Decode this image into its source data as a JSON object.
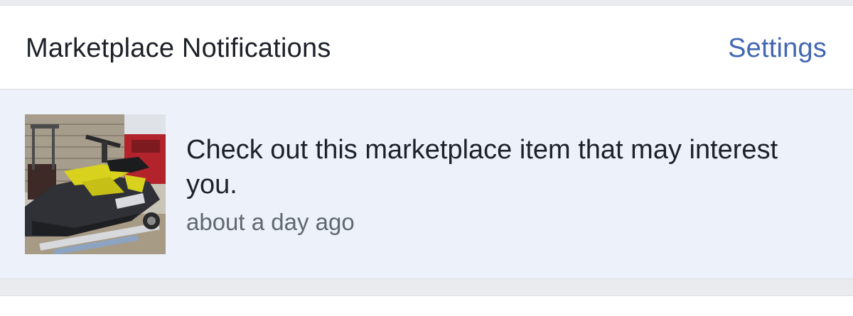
{
  "header": {
    "title": "Marketplace Notifications",
    "settings_label": "Settings"
  },
  "notification": {
    "message": "Check out this marketplace item that may interest you.",
    "time": "about a day ago",
    "thumbnail": "jet-ski-photo"
  },
  "colors": {
    "accent": "#4267b2",
    "unread_background": "#edf2fa",
    "page_background": "#e9ebee",
    "primary_text": "#1d2129",
    "secondary_text": "#606770"
  }
}
